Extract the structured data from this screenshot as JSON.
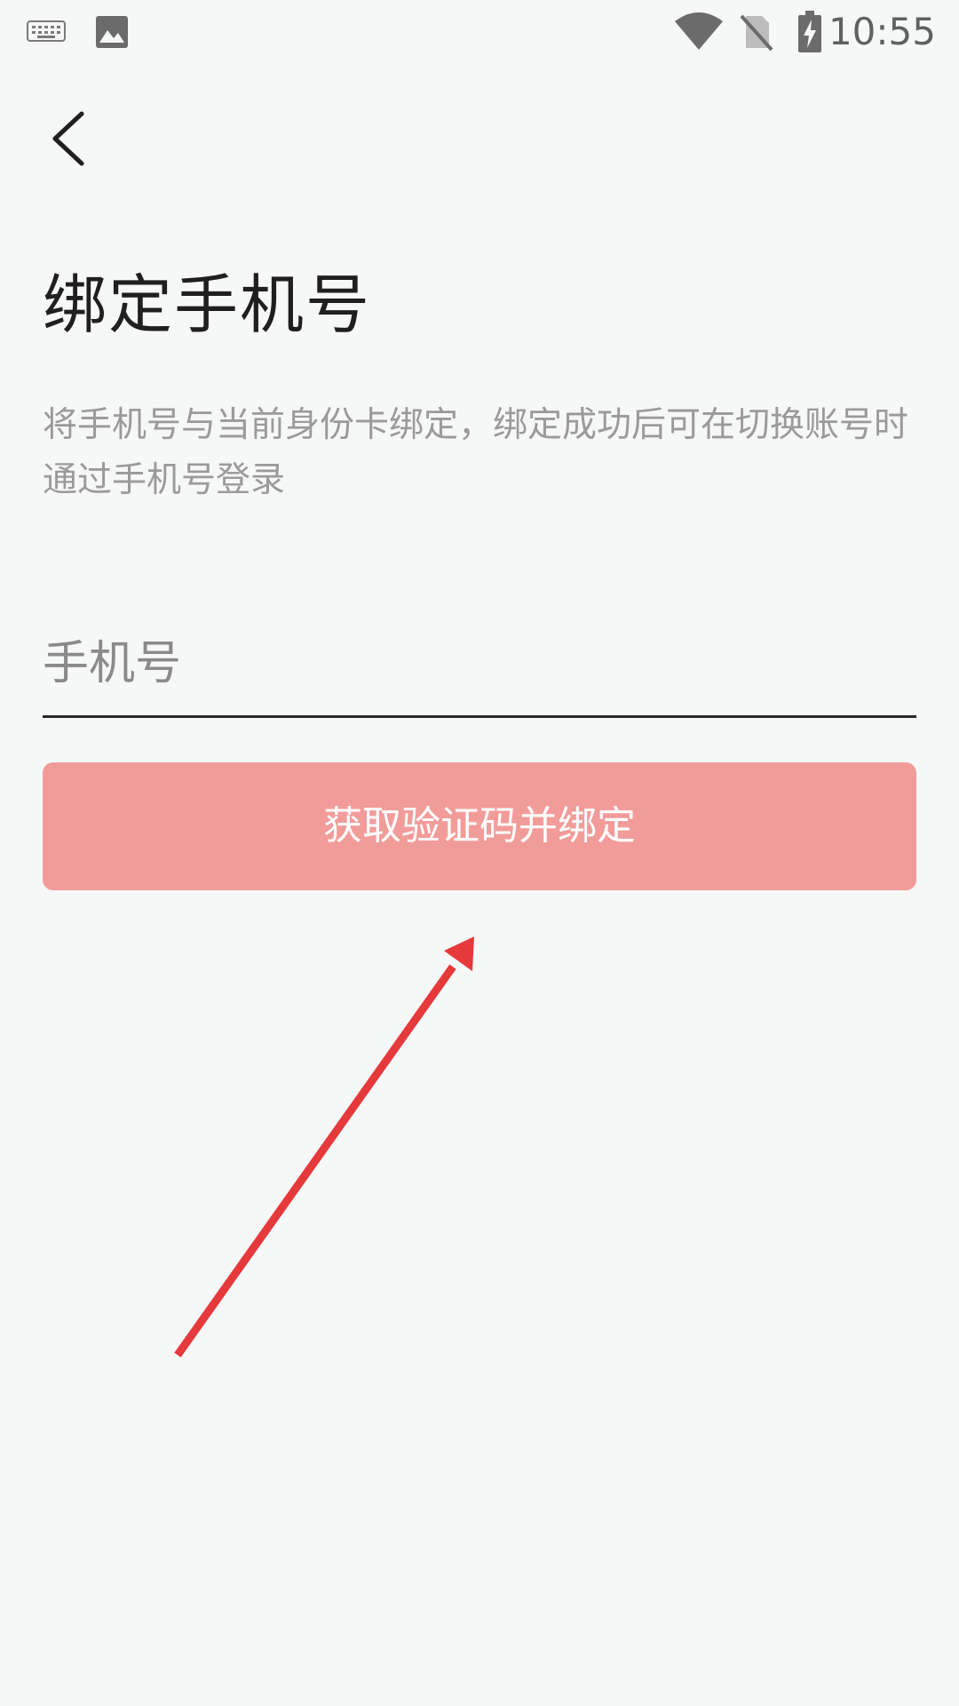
{
  "status_bar": {
    "time": "10:55",
    "icons": [
      "keyboard-icon",
      "image-icon",
      "wifi-icon",
      "no-sim-icon",
      "battery-charging-icon"
    ]
  },
  "nav": {
    "back_icon": "chevron-left-icon"
  },
  "main": {
    "title": "绑定手机号",
    "description": "将手机号与当前身份卡绑定，绑定成功后可在切换账号时通过手机号登录",
    "phone_input": {
      "placeholder": "手机号",
      "value": ""
    },
    "submit_label": "获取验证码并绑定"
  },
  "annotation": {
    "type": "arrow",
    "color": "#e5393b"
  },
  "colors": {
    "background": "#f6f7f7",
    "button": "#f29c9a",
    "title": "#1f1f1f",
    "description": "#9a9a9a"
  }
}
